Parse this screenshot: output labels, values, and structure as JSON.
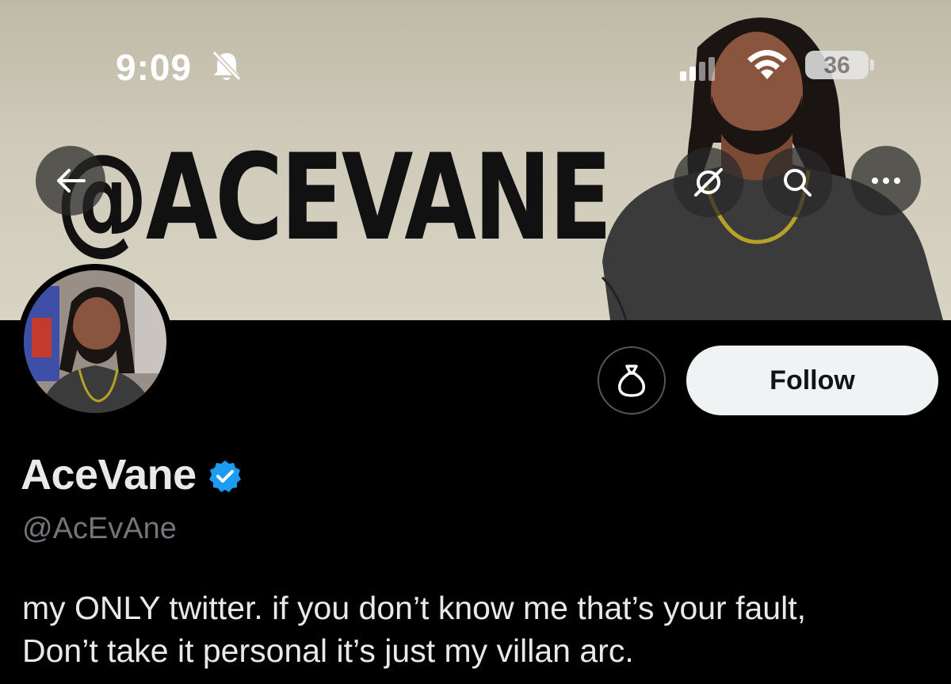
{
  "status_bar": {
    "time": "9:09",
    "battery_level": "36",
    "icons": [
      "bell-muted-icon",
      "cellular-signal-icon",
      "wifi-icon",
      "battery-icon"
    ]
  },
  "header": {
    "banner_text": "@ACEVANE",
    "buttons": [
      {
        "name": "back-button",
        "icon": "arrow-left-icon"
      },
      {
        "name": "grok-button",
        "icon": "grok-icon"
      },
      {
        "name": "search-button",
        "icon": "search-icon"
      },
      {
        "name": "more-button",
        "icon": "more-horizontal-icon"
      }
    ]
  },
  "profile": {
    "display_name": "AceVane",
    "verified": true,
    "handle": "@AcEvAne",
    "bio_line1": "my ONLY twitter. if you don’t know me that’s your fault,",
    "bio_line2": "Don’t take it personal it’s just my villan arc."
  },
  "actions": {
    "tip_icon": "money-bag-icon",
    "follow_label": "Follow"
  },
  "colors": {
    "background": "#000000",
    "banner": "#cfcab9",
    "text_primary": "#e7e9ea",
    "text_secondary": "#71767b",
    "verified_blue": "#1d9bf0",
    "follow_bg": "#eff3f4"
  }
}
